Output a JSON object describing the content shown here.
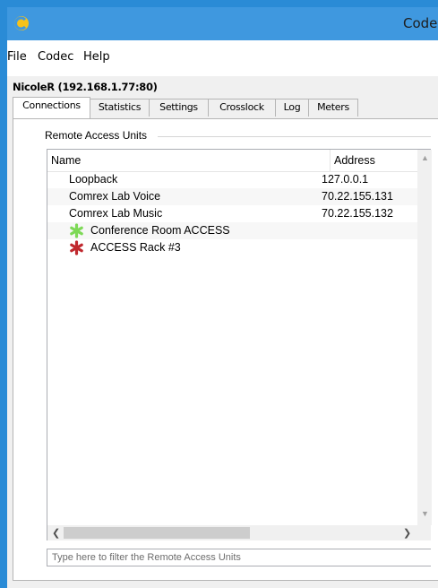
{
  "window": {
    "title": "Code"
  },
  "menu": {
    "file": "File",
    "codec": "Codec",
    "help": "Help"
  },
  "device": {
    "title": "NicoleR (192.168.1.77:80)"
  },
  "tabs": [
    {
      "label": "Connections",
      "active": true
    },
    {
      "label": "Statistics"
    },
    {
      "label": "Settings"
    },
    {
      "label": "Crosslock"
    },
    {
      "label": "Log"
    },
    {
      "label": "Meters"
    }
  ],
  "group": {
    "label": "Remote Access Units"
  },
  "list": {
    "headers": {
      "name": "Name",
      "address": "Address"
    },
    "rows": [
      {
        "name": "Loopback",
        "address": "127.0.0.1"
      },
      {
        "name": "Comrex Lab Voice",
        "address": "70.22.155.131"
      },
      {
        "name": "Comrex Lab Music",
        "address": "70.22.155.132"
      },
      {
        "name": "Conference Room ACCESS",
        "address": "",
        "icon": "green-asterisk-icon"
      },
      {
        "name": "ACCESS Rack #3",
        "address": "",
        "icon": "red-asterisk-icon"
      }
    ]
  },
  "filter": {
    "placeholder": "Type here to filter the Remote Access Units"
  },
  "colors": {
    "online": "#7ed957",
    "offline": "#c0282e",
    "titlebar": "#3f98df"
  }
}
